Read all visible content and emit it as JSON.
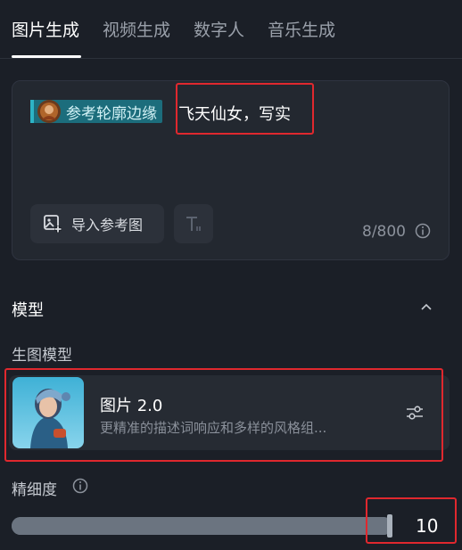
{
  "tabs": [
    {
      "label": "图片生成",
      "active": true
    },
    {
      "label": "视频生成",
      "active": false
    },
    {
      "label": "数字人",
      "active": false
    },
    {
      "label": "音乐生成",
      "active": false
    }
  ],
  "prompt": {
    "reference_chip_label": "参考轮廓边缘",
    "text": "飞天仙女，写实",
    "import_button_label": "导入参考图",
    "char_count": "8/800"
  },
  "model_section": {
    "title": "模型",
    "subtitle": "生图模型",
    "model": {
      "name": "图片 2.0",
      "description": "更精准的描述词响应和多样的风格组..."
    }
  },
  "precision": {
    "label": "精细度",
    "value": "10",
    "slider_fraction": 1.0
  },
  "colors": {
    "background": "#1b1f27",
    "panel": "#232830",
    "chip": "#1c6d7c",
    "highlight": "#e0282e"
  },
  "icons": {
    "import": "image-add-icon",
    "text_format": "text-format-icon",
    "info": "info-icon",
    "collapse": "chevron-up-icon",
    "settings": "sliders-icon"
  }
}
